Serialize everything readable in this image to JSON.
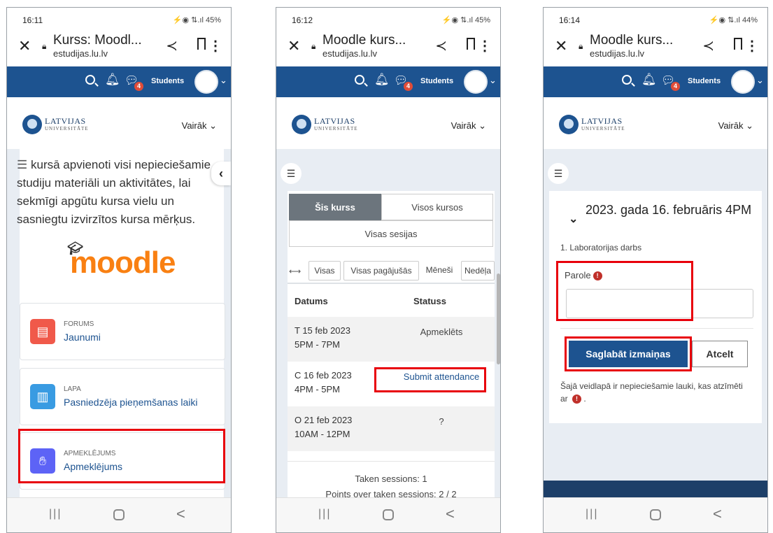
{
  "screen1": {
    "status_time": "16:11",
    "status_right": "⚡◉ ⇅.ıl 45%",
    "tab_title": "Kurss: Moodl...",
    "domain": "estudijas.lu.lv",
    "role": "Students",
    "badge": "4",
    "logo_title": "LATVIJAS",
    "logo_sub": "UNIVERSITĀTE",
    "more": "Vairāk ⌄",
    "intro": "kursā apvienoti visi nepieciešamie studiju materiāli un aktivitātes, lai sekmīgi apgūtu kursa vielu un sasniegtu izvirzītos kursa mērķus.",
    "moodle_logo": "moodle",
    "activities": [
      {
        "type": "FORUMS",
        "name": "Jaunumi",
        "color": "#f0594a"
      },
      {
        "type": "LAPA",
        "name": "Pasniedzēja pieņemšanas laiki",
        "color": "#399be2"
      },
      {
        "type": "APMEKLĒJUMS",
        "name": "Apmeklējums",
        "color": "#5d63f6"
      }
    ]
  },
  "screen2": {
    "status_time": "16:12",
    "status_right": "⚡◉ ⇅.ıl 45%",
    "tab_title": "Moodle kurs...",
    "domain": "estudijas.lu.lv",
    "role": "Students",
    "badge": "4",
    "logo_title": "LATVIJAS",
    "logo_sub": "UNIVERSITĀTE",
    "more": "Vairāk ⌄",
    "tabs": [
      "Šis kurss",
      "Visos kursos",
      "Visas sesijas"
    ],
    "filters": [
      "Visas",
      "Visas pagājušās",
      "Mēneši",
      "Nedēļa"
    ],
    "columns": [
      "Datums",
      "Statuss"
    ],
    "rows": [
      {
        "date": "T  15 feb 2023",
        "time": "5PM - 7PM",
        "status": "Apmeklēts"
      },
      {
        "date": "C  16 feb 2023",
        "time": "4PM - 5PM",
        "status": "Submit attendance"
      },
      {
        "date": "O  21 feb 2023",
        "time": "10AM - 12PM",
        "status": "?"
      }
    ],
    "summary_taken": "Taken sessions: 1",
    "summary_points": "Points over taken sessions: 2 / 2"
  },
  "screen3": {
    "status_time": "16:14",
    "status_right": "⚡◉ ⇅.ıl 44%",
    "tab_title": "Moodle kurs...",
    "domain": "estudijas.lu.lv",
    "role": "Students",
    "badge": "4",
    "logo_title": "LATVIJAS",
    "logo_sub": "UNIVERSITĀTE",
    "more": "Vairāk ⌄",
    "session_title": "2023. gada 16. februāris 4PM",
    "session_sub": "1. Laboratorijas darbs",
    "password_label": "Parole",
    "save_label": "Saglabāt izmaiņas",
    "cancel_label": "Atcelt",
    "required_note": "Šajā veidlapā ir nepieciešamie lauki, kas atzīmēti ar",
    "required_mark": "!",
    "required_end": "."
  },
  "nav": {
    "recent": "|||",
    "back": "<"
  },
  "colors": {
    "navbar": "#1d5390",
    "highlight": "#e8000b",
    "link": "#1d5390"
  }
}
